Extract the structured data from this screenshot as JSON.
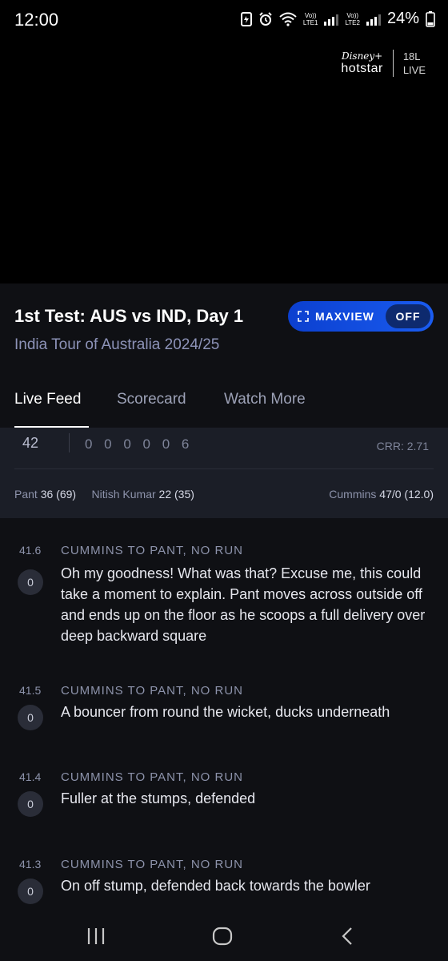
{
  "status": {
    "time": "12:00",
    "network1": "LTE1",
    "network2": "LTE2",
    "volte": "Vo))",
    "battery": "24%"
  },
  "video": {
    "brand_top": "Disney+",
    "brand_bottom": "hotstar",
    "age_rating": "18L",
    "live_label": "LIVE"
  },
  "match": {
    "title": "1st Test: AUS vs IND, Day 1",
    "subtitle": "India Tour of Australia 2024/25"
  },
  "maxview": {
    "label": "MAXVIEW",
    "state": "OFF"
  },
  "tabs": [
    {
      "label": "Live Feed",
      "active": true
    },
    {
      "label": "Scorecard",
      "active": false
    },
    {
      "label": "Watch More",
      "active": false
    }
  ],
  "score": {
    "runs": "42",
    "balls": "0 0 0 0 0 6",
    "crr": "CRR: 2.71",
    "batter1_name": "Pant",
    "batter1_score": "36 (69)",
    "batter2_name": "Nitish Kumar",
    "batter2_score": "22 (35)",
    "bowler_name": "Cummins",
    "bowler_figures": "47/0 (12.0)"
  },
  "feed": [
    {
      "over": "41.6",
      "header": "CUMMINS TO PANT, NO RUN",
      "runs": "0",
      "text": "Oh my goodness! What was that? Excuse me, this could take a moment to explain. Pant moves across outside off and ends up on the floor as he scoops a full delivery over deep backward square"
    },
    {
      "over": "41.5",
      "header": "CUMMINS TO PANT, NO RUN",
      "runs": "0",
      "text": "A bouncer from round the wicket, ducks underneath"
    },
    {
      "over": "41.4",
      "header": "CUMMINS TO PANT, NO RUN",
      "runs": "0",
      "text": "Fuller at the stumps, defended"
    },
    {
      "over": "41.3",
      "header": "CUMMINS TO PANT, NO RUN",
      "runs": "0",
      "text": "On off stump, defended back towards the bowler"
    }
  ],
  "icons": {
    "status": [
      "data-saver-icon",
      "alarm-icon",
      "wifi-icon",
      "signal-icon",
      "battery-icon"
    ],
    "nav": [
      "recents-icon",
      "home-icon",
      "back-icon"
    ]
  }
}
